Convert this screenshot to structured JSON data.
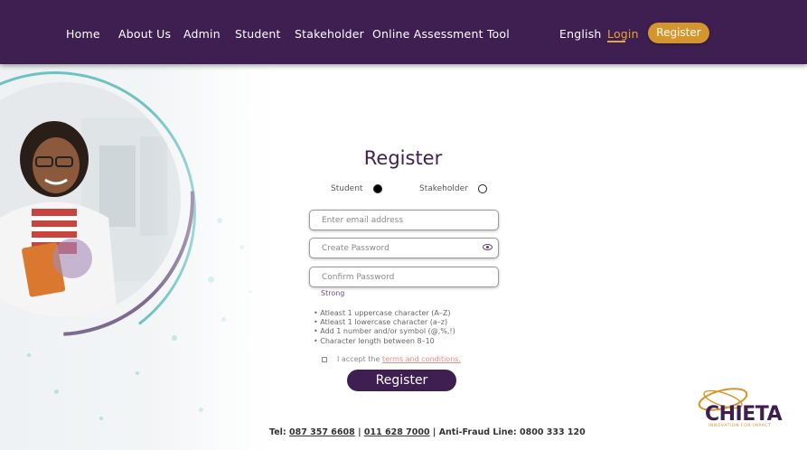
{
  "nav": {
    "items": [
      {
        "label": "Home"
      },
      {
        "label": "About Us"
      },
      {
        "label": "Admin"
      },
      {
        "label": "Student"
      },
      {
        "label": "Stakeholder"
      },
      {
        "label": "Online Assessment Tool"
      }
    ],
    "language": "English",
    "login": "Login",
    "register": "Register"
  },
  "colors": {
    "brand_purple": "#3f1f52",
    "accent_orange": "#d4952c",
    "link_red": "#e58a8a"
  },
  "form": {
    "title": "Register",
    "roles": [
      {
        "label": "Student",
        "selected": true
      },
      {
        "label": "Stakeholder",
        "selected": false
      }
    ],
    "email_placeholder": "Enter email address",
    "password_placeholder": "Create Password",
    "confirm_placeholder": "Confirm Password",
    "strength": "Strong",
    "rules": [
      "• Atleast 1 uppercase character (A–Z)",
      "• Atleast 1 lowercase character (a–z)",
      "• Add 1 number and/or symbol (@,%,!)",
      "• Character length between 8–10"
    ],
    "terms_prefix": "I accept the",
    "terms_link": "terms and conditions.",
    "submit": "Register"
  },
  "footer": {
    "tel_label": "Tel:",
    "tel1": "087 357 6608",
    "separator": "|",
    "tel2": "011 628 7000",
    "anti_fraud": "Anti-Fraud Line: 0800 333 120"
  },
  "logo": {
    "name": "CHIETA",
    "tagline": "INNOVATION FOR IMPACT"
  }
}
